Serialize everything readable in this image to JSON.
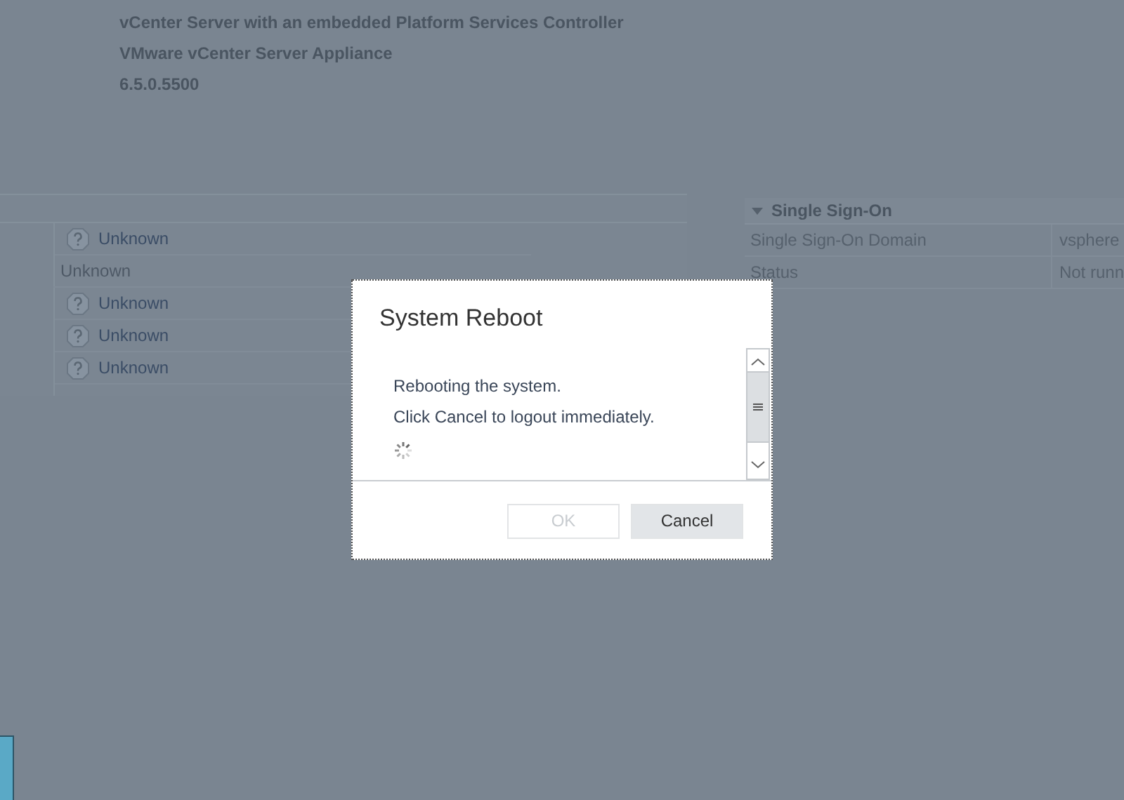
{
  "header": {
    "lines": [
      "vCenter Server with an embedded Platform Services Controller",
      "VMware vCenter Server Appliance",
      "6.5.0.5500"
    ]
  },
  "left_panel": {
    "rows": [
      {
        "kind": "status",
        "text": "Unknown"
      },
      {
        "kind": "plain",
        "text": "Unknown"
      },
      {
        "kind": "status",
        "text": "Unknown"
      },
      {
        "kind": "status",
        "text": "Unknown"
      },
      {
        "kind": "status",
        "text": "Unknown"
      }
    ]
  },
  "single_sign_on": {
    "title": "Single Sign-On",
    "expanded": true,
    "rows": [
      {
        "label": "Single Sign-On Domain",
        "value": "vsphere"
      },
      {
        "label": "Status",
        "value": "Not runn"
      }
    ]
  },
  "dialog": {
    "title": "System Reboot",
    "messages": [
      "Rebooting the system.",
      "Click Cancel to logout immediately."
    ],
    "buttons": [
      {
        "label": "OK",
        "disabled": true
      },
      {
        "label": "Cancel",
        "disabled": false
      }
    ]
  }
}
